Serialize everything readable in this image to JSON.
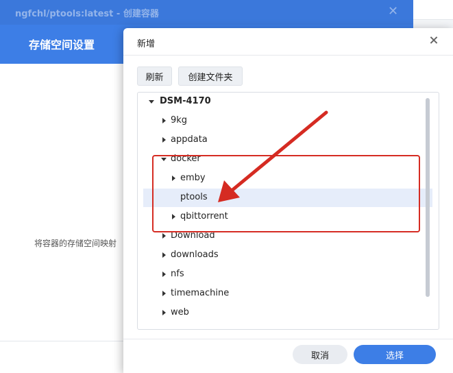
{
  "background_window": {
    "title": "ngfchl/ptools:latest - 创建容器",
    "close_glyph": "✕",
    "header_title": "存储空间设置",
    "description": "将容器的存储空间映射"
  },
  "dialog": {
    "title": "新增",
    "toolbar": {
      "refresh_label": "刷新",
      "new_folder_label": "创建文件夹"
    },
    "tree": {
      "root": "DSM-4170",
      "items": [
        {
          "label": "9kg",
          "expanded": false
        },
        {
          "label": "appdata",
          "expanded": false
        },
        {
          "label": "docker",
          "expanded": true,
          "children": [
            {
              "label": "emby",
              "expanded": false
            },
            {
              "label": "ptools",
              "selected": true
            },
            {
              "label": "qbittorrent",
              "expanded": false
            }
          ]
        },
        {
          "label": "Download",
          "expanded": false
        },
        {
          "label": "downloads",
          "expanded": false
        },
        {
          "label": "nfs",
          "expanded": false
        },
        {
          "label": "timemachine",
          "expanded": false
        },
        {
          "label": "web",
          "expanded": false
        }
      ]
    },
    "footer": {
      "cancel_label": "取消",
      "select_label": "选择"
    }
  },
  "colors": {
    "accent": "#3d7ee6",
    "annotation": "#d52b22",
    "selected_row": "#e6edfa"
  }
}
